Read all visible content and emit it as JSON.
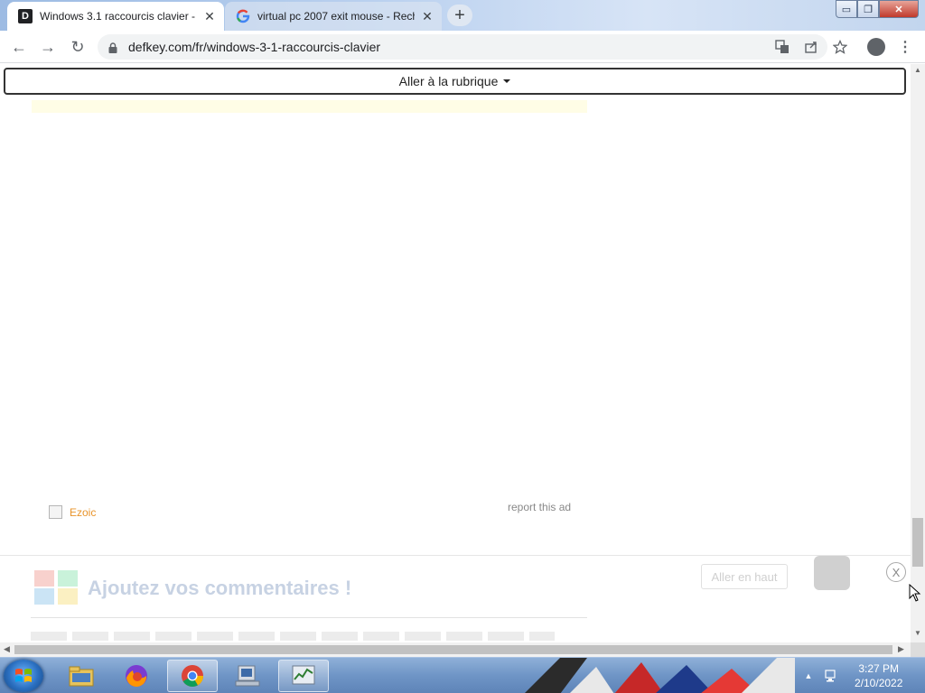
{
  "browser": {
    "tabs": [
      {
        "title": "Windows 3.1 raccourcis clavier -",
        "active": true,
        "favicon": "defkey-d-icon"
      },
      {
        "title": "virtual pc 2007 exit mouse - Rech",
        "active": false,
        "favicon": "google-g-icon"
      }
    ],
    "close_glyph": "✕",
    "newtab_glyph": "+",
    "url": "defkey.com/fr/windows-3-1-raccourcis-clavier",
    "nav": {
      "back": "←",
      "forward": "→",
      "reload": "↻"
    },
    "window_controls": {
      "minimize": "▭",
      "maximize": "❐",
      "close": "✕"
    },
    "menu_glyph": "⋮"
  },
  "page": {
    "section_select": "Aller à la rubrique",
    "ad": {
      "ezoic_label": "Ezoic",
      "report_label": "report this ad"
    },
    "comments": {
      "title": "Ajoutez vos commentaires !"
    },
    "back_to_top": "Aller en haut",
    "close_ad": "X"
  },
  "taskbar": {
    "apps": [
      "file-explorer-icon",
      "firefox-icon",
      "chrome-icon",
      "virtual-pc-icon",
      "task-manager-icon"
    ],
    "clock_time": "3:27 PM",
    "clock_date": "2/10/2022",
    "tray_arrow": "▲"
  },
  "colors": {
    "ezoic": "#e8932a",
    "close_window": "#c0392b",
    "taskbar": "#6f95c6"
  }
}
